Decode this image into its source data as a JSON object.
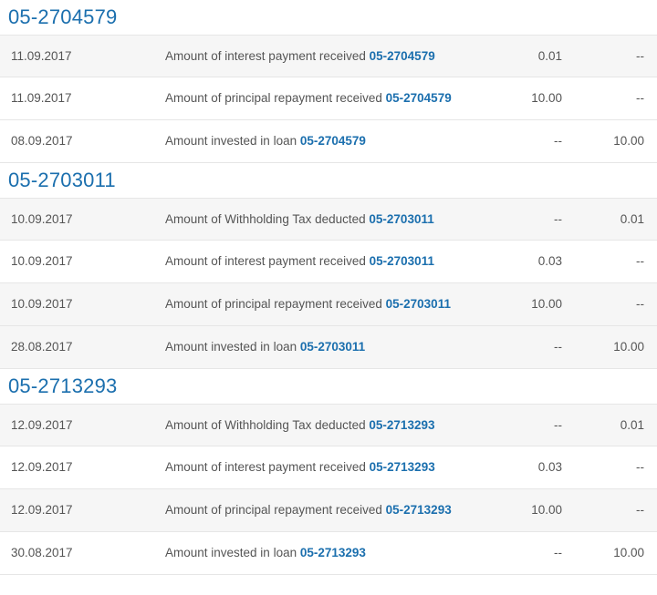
{
  "groups": [
    {
      "title": "05-2704579",
      "rows": [
        {
          "date": "11.09.2017",
          "desc": "Amount of interest payment received",
          "loan": "05-2704579",
          "col1": "0.01",
          "col2": "--"
        },
        {
          "date": "11.09.2017",
          "desc": "Amount of principal repayment received",
          "loan": "05-2704579",
          "col1": "10.00",
          "col2": "--"
        },
        {
          "date": "08.09.2017",
          "desc": "Amount invested in loan",
          "loan": "05-2704579",
          "col1": "--",
          "col2": "10.00"
        }
      ]
    },
    {
      "title": "05-2703011",
      "rows": [
        {
          "date": "10.09.2017",
          "desc": "Amount of Withholding Tax deducted",
          "loan": "05-2703011",
          "col1": "--",
          "col2": "0.01"
        },
        {
          "date": "10.09.2017",
          "desc": "Amount of interest payment received",
          "loan": "05-2703011",
          "col1": "0.03",
          "col2": "--"
        },
        {
          "date": "10.09.2017",
          "desc": "Amount of principal repayment received",
          "loan": "05-2703011",
          "col1": "10.00",
          "col2": "--"
        },
        {
          "date": "28.08.2017",
          "desc": "Amount invested in loan",
          "loan": "05-2703011",
          "col1": "--",
          "col2": "10.00"
        }
      ]
    },
    {
      "title": "05-2713293",
      "rows": [
        {
          "date": "12.09.2017",
          "desc": "Amount of Withholding Tax deducted",
          "loan": "05-2713293",
          "col1": "--",
          "col2": "0.01"
        },
        {
          "date": "12.09.2017",
          "desc": "Amount of interest payment received",
          "loan": "05-2713293",
          "col1": "0.03",
          "col2": "--"
        },
        {
          "date": "12.09.2017",
          "desc": "Amount of principal repayment received",
          "loan": "05-2713293",
          "col1": "10.00",
          "col2": "--"
        },
        {
          "date": "30.08.2017",
          "desc": "Amount invested in loan",
          "loan": "05-2713293",
          "col1": "--",
          "col2": "10.00"
        }
      ]
    }
  ],
  "colors": {
    "link": "#1b6fae",
    "text": "#555555",
    "row_shade": "#f6f6f6",
    "border": "#e6e6e6"
  }
}
